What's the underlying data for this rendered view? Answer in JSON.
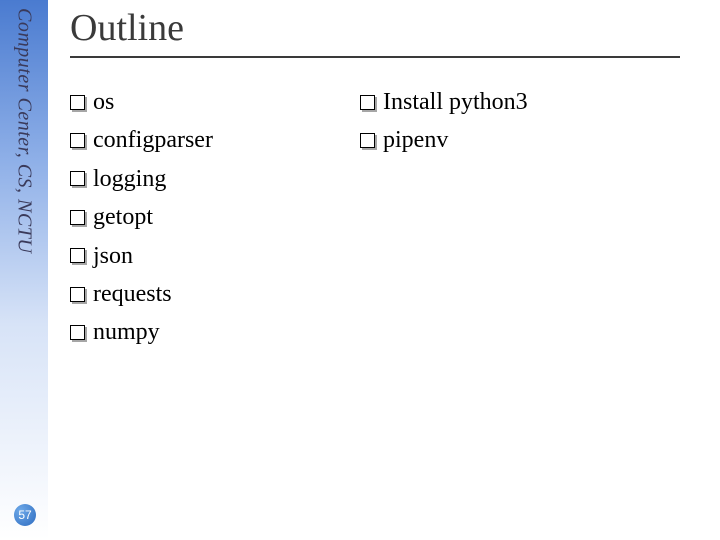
{
  "sidebar": {
    "org_text": "Computer Center, CS, NCTU"
  },
  "page_number": "57",
  "title": "Outline",
  "columns": {
    "left": [
      "os",
      "configparser",
      "logging",
      "getopt",
      "json",
      "requests",
      "numpy"
    ],
    "right": [
      "Install python3",
      "pipenv"
    ]
  }
}
